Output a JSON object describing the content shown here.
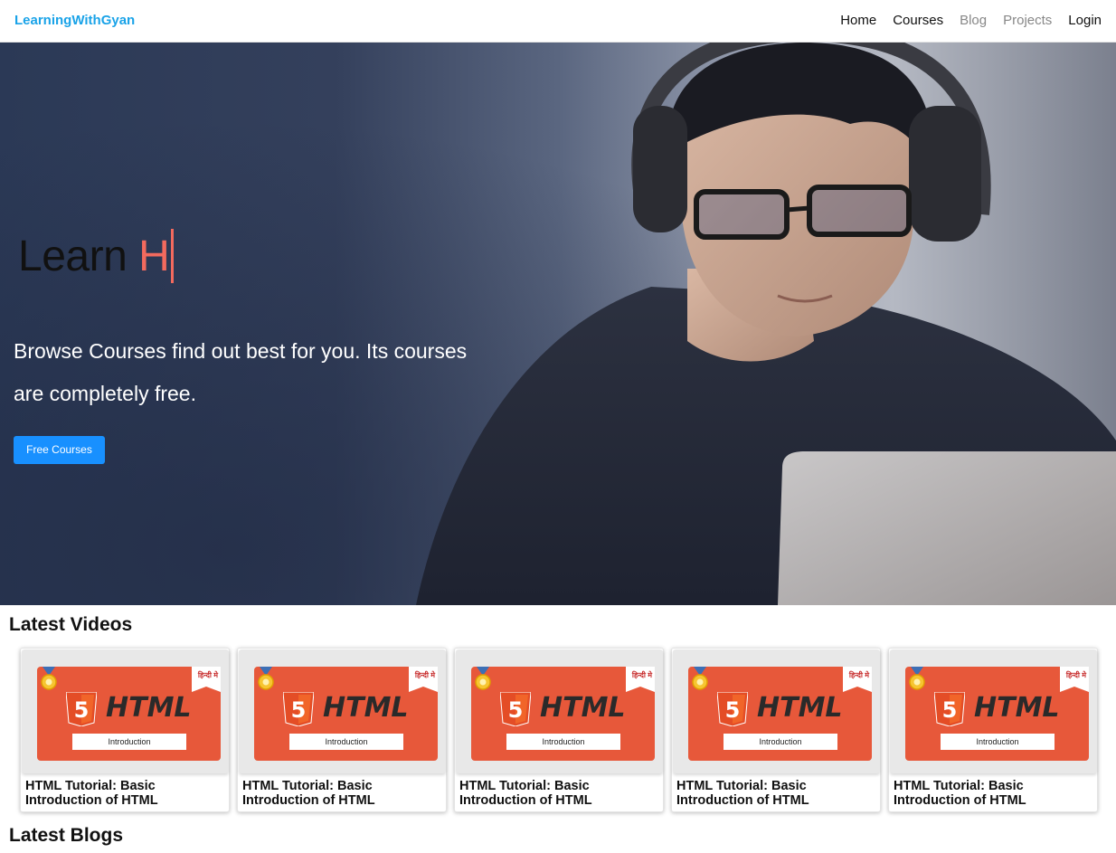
{
  "navbar": {
    "brand": "LearningWithGyan",
    "links": [
      {
        "label": "Home",
        "muted": false
      },
      {
        "label": "Courses",
        "muted": false
      },
      {
        "label": "Blog",
        "muted": true
      },
      {
        "label": "Projects",
        "muted": true
      },
      {
        "label": "Login",
        "muted": false
      }
    ]
  },
  "hero": {
    "heading_static": "Learn",
    "heading_typed": "H",
    "subtitle": "Browse Courses find out best for you. Its courses are completely free.",
    "button_label": "Free Courses"
  },
  "sections": {
    "videos_title": "Latest Videos",
    "blogs_title": "Latest Blogs"
  },
  "videos": [
    {
      "thumb_badge": "हिन्दी मे",
      "thumb_word": "HTML",
      "thumb_caption": "Introduction",
      "title": "HTML Tutorial: Basic Introduction of HTML"
    },
    {
      "thumb_badge": "हिन्दी मे",
      "thumb_word": "HTML",
      "thumb_caption": "Introduction",
      "title": "HTML Tutorial: Basic Introduction of HTML"
    },
    {
      "thumb_badge": "हिन्दी मे",
      "thumb_word": "HTML",
      "thumb_caption": "Introduction",
      "title": "HTML Tutorial: Basic Introduction of HTML"
    },
    {
      "thumb_badge": "हिन्दी मे",
      "thumb_word": "HTML",
      "thumb_caption": "Introduction",
      "title": "HTML Tutorial: Basic Introduction of HTML"
    },
    {
      "thumb_badge": "हिन्दी मे",
      "thumb_word": "HTML",
      "thumb_caption": "Introduction",
      "title": "HTML Tutorial: Basic Introduction of HTML"
    }
  ],
  "colors": {
    "brand": "#1aa3e8",
    "accent_button": "#1890ff",
    "typed_text": "#f36a5e",
    "thumb_bg": "#e7583a"
  }
}
